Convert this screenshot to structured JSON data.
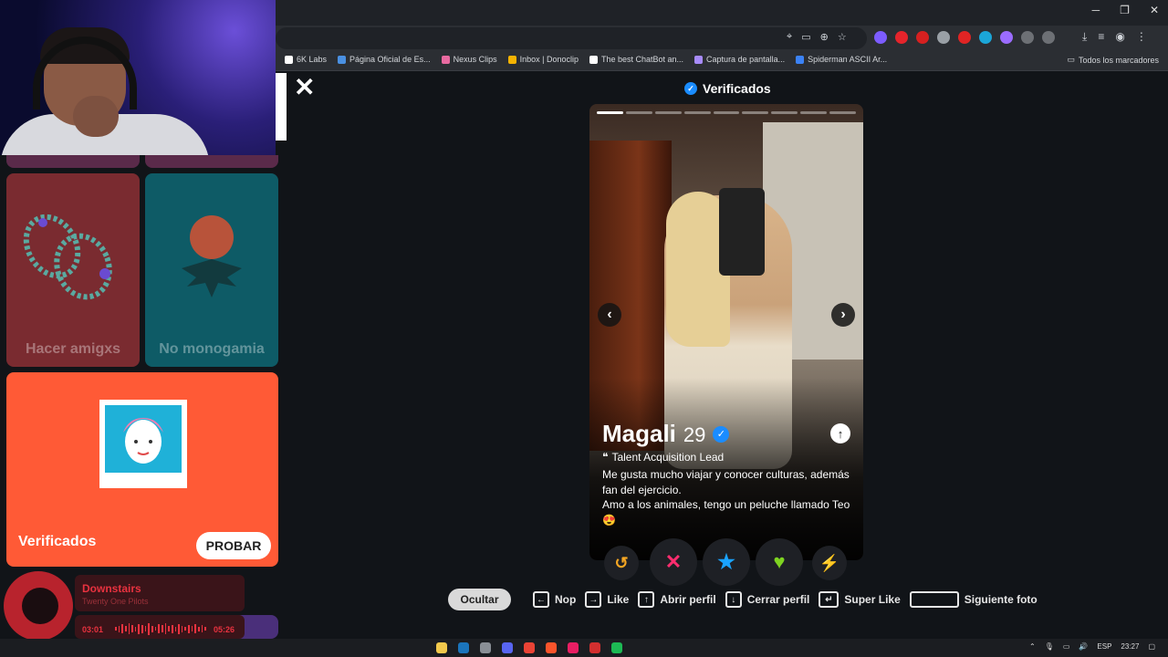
{
  "browser": {
    "bookmarks": [
      {
        "label": "6K Labs",
        "color": "#ffffff"
      },
      {
        "label": "Página Oficial de Es...",
        "color": "#4a90e2"
      },
      {
        "label": "Nexus Clips",
        "color": "#e86aa0"
      },
      {
        "label": "Inbox | Donoclip",
        "color": "#f5b301"
      },
      {
        "label": "The best ChatBot an...",
        "color": "#ffffff"
      },
      {
        "label": "Captura de pantalla...",
        "color": "#a78bfa"
      },
      {
        "label": "Spiderman ASCII Ar...",
        "color": "#3b82f6"
      }
    ],
    "all_bookmarks": "Todos los marcadores"
  },
  "sidebar": {
    "cards": [
      {
        "label": "Hacer amigxs",
        "color": "#7a2b30"
      },
      {
        "label": "No monogamia",
        "color": "#0e5b66"
      }
    ],
    "verified_card": {
      "title": "Verificados",
      "button": "PROBAR",
      "color": "#ff5a36"
    }
  },
  "music": {
    "title": "Downstairs",
    "artist": "Twenty One Pilots",
    "current_time": "03:01",
    "total_time": "05:26"
  },
  "main": {
    "header": "Verificados",
    "profile": {
      "name": "Magali",
      "age": "29",
      "job": "Talent Acquisition Lead",
      "bio": "Me gusta mucho viajar y conocer culturas, además fan del ejercicio.\nAmo a los animales, tengo un peluche llamado Teo 😍",
      "photo_count": 9,
      "current_photo": 1
    },
    "actions": [
      {
        "name": "rewind-icon",
        "glyph": "↺",
        "color": "#f5a623"
      },
      {
        "name": "nope-icon",
        "glyph": "✕",
        "color": "#ff2d6f"
      },
      {
        "name": "super-like-icon",
        "glyph": "★",
        "color": "#1aa3ff"
      },
      {
        "name": "like-icon",
        "glyph": "♥",
        "color": "#7ed321"
      },
      {
        "name": "boost-icon",
        "glyph": "⚡",
        "color": "#b44dff"
      }
    ]
  },
  "shortcuts": {
    "hide": "Ocultar",
    "nope": "Nop",
    "like": "Like",
    "open_profile": "Abrir perfil",
    "close_profile": "Cerrar perfil",
    "super_like": "Super Like",
    "next_photo": "Siguiente foto"
  },
  "taskbar": {
    "lang": "ESP",
    "time": "23:27"
  }
}
